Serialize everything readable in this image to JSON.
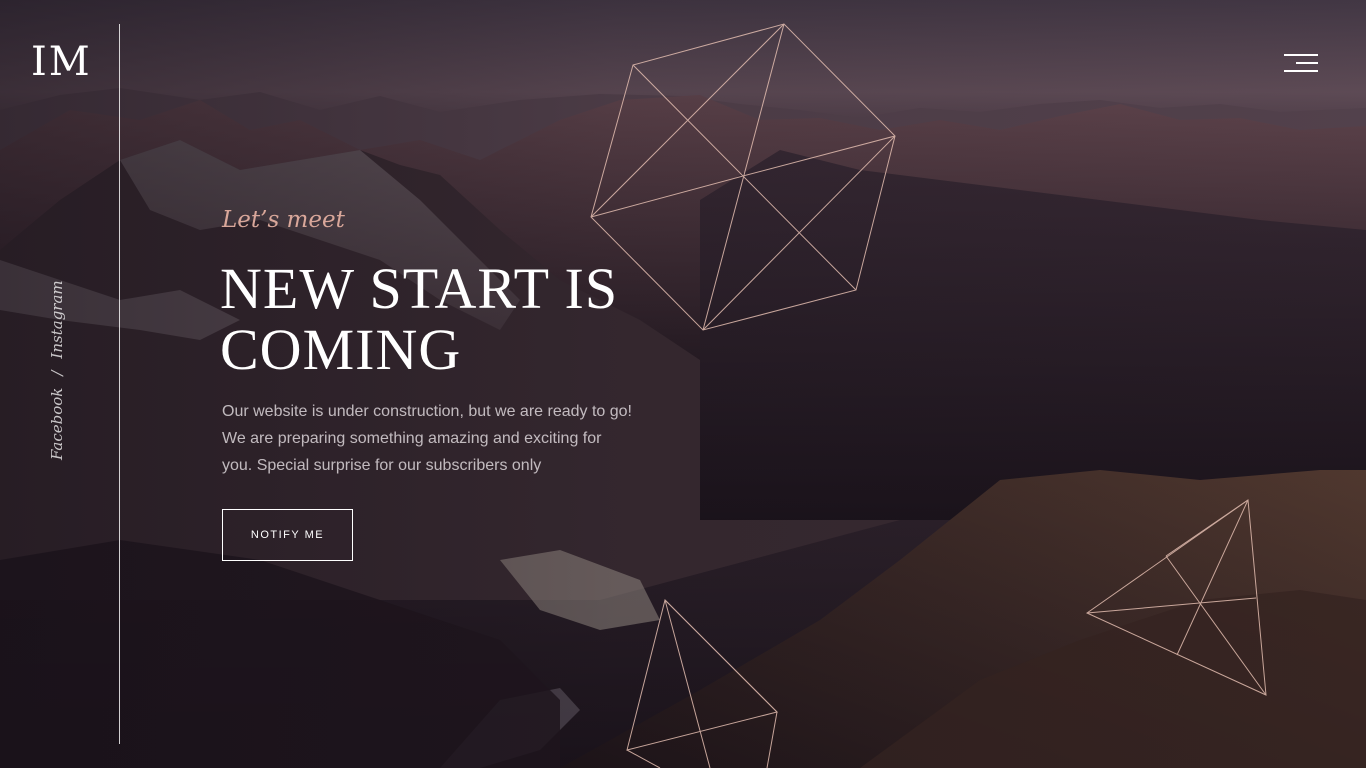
{
  "brand": {
    "logo_text": "IM"
  },
  "social": {
    "facebook": "Facebook",
    "separator": "/",
    "instagram": "Instagram"
  },
  "hero": {
    "eyebrow": "Let’s meet",
    "headline": "NEW START IS COMING",
    "description": "Our website is under construction, but we are ready to go! We are preparing something amazing and exciting for you. Special surprise for our subscribers only",
    "button_label": "NOTIFY ME"
  },
  "icons": {
    "menu": "hamburger-menu-icon"
  },
  "colors": {
    "accent": "#d9a79a",
    "text": "#ffffff",
    "geometry_stroke": "#e3bdb0"
  }
}
